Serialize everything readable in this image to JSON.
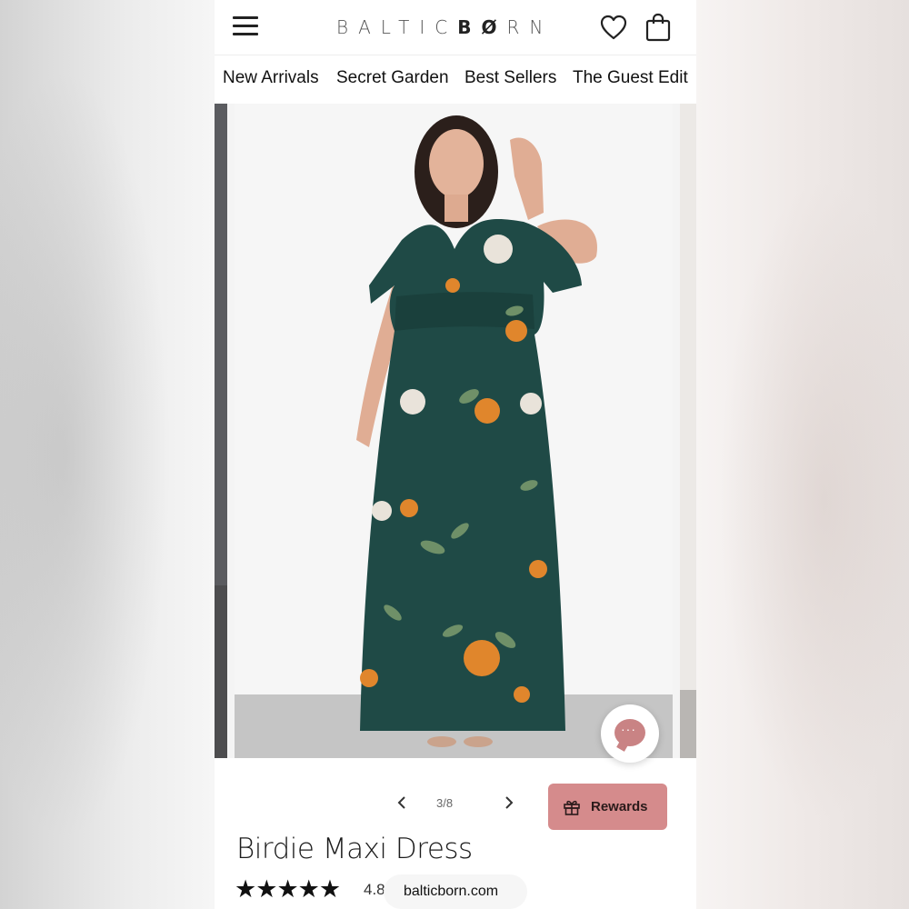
{
  "brand": {
    "logo_light": "BALTIC",
    "logo_bold": "BØ",
    "logo_rest": "RN"
  },
  "header": {
    "menu_icon": "hamburger-menu-icon",
    "wishlist_icon": "heart-icon",
    "cart_icon": "shopping-bag-icon"
  },
  "nav": {
    "items": [
      "New Arrivals",
      "Secret Garden",
      "Best Sellers",
      "The Guest Edit"
    ]
  },
  "gallery": {
    "counter": "3/8",
    "prev_icon": "chevron-left-icon",
    "next_icon": "chevron-right-icon"
  },
  "chat": {
    "icon": "chat-bubble-icon",
    "dots": "···"
  },
  "rewards": {
    "label": "Rewards",
    "icon": "gift-icon",
    "color": "#d58b8c"
  },
  "product": {
    "name": "Birdie Maxi Dress",
    "rating": "4.8",
    "stars": 5
  },
  "browser": {
    "url": "balticborn.com"
  },
  "colors": {
    "dress": "#1f4a46",
    "flower_orange": "#e0862c",
    "flower_white": "#e9e3da",
    "leaf": "#6f9068",
    "accent": "#c98384"
  }
}
